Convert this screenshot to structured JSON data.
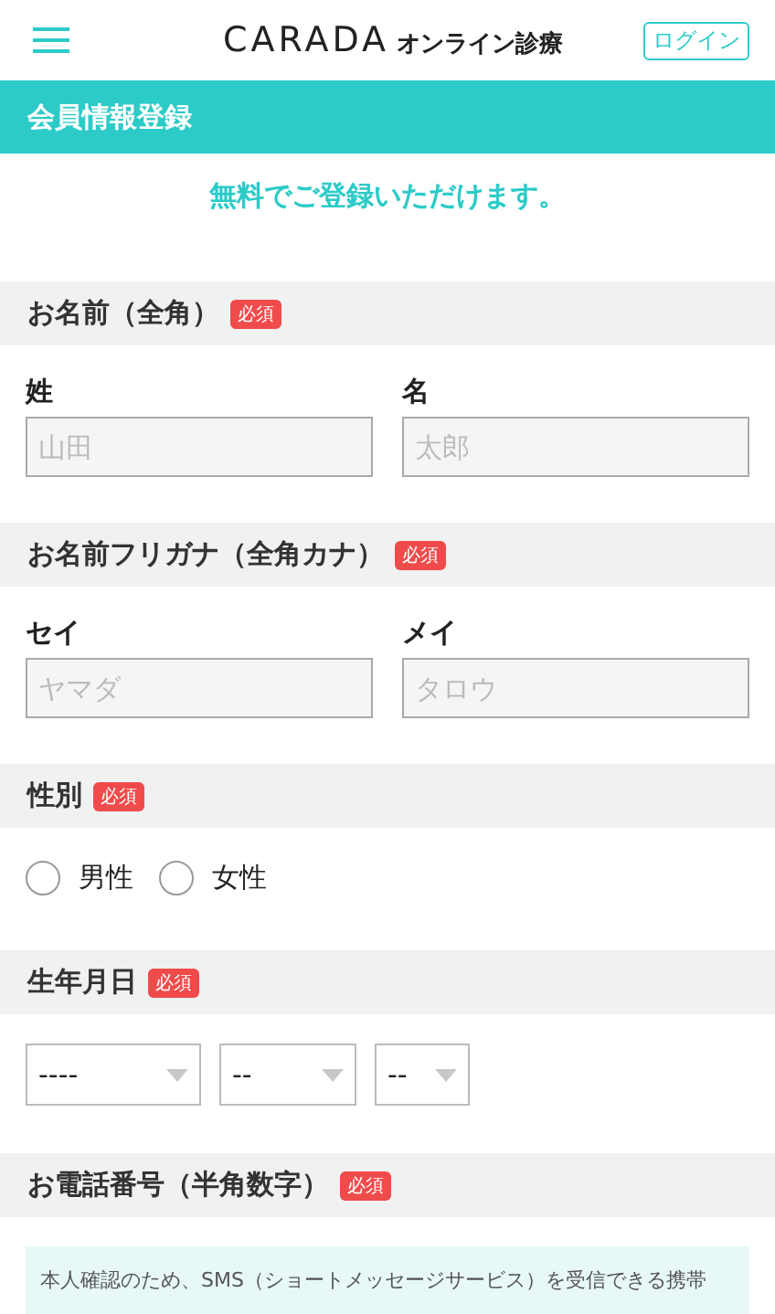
{
  "header": {
    "logo": "CARADA",
    "logo_sub": "オンライン診療",
    "login": "ログイン"
  },
  "page_title": "会員情報登録",
  "lead": "無料でご登録いただけます。",
  "sections": [
    {
      "kind": "text_pair",
      "title": "お名前（全角）",
      "badge": "必須",
      "fields": [
        {
          "label": "姓",
          "placeholder": "山田"
        },
        {
          "label": "名",
          "placeholder": "太郎"
        }
      ]
    },
    {
      "kind": "text_pair",
      "title": "お名前フリガナ（全角カナ）",
      "badge": "必須",
      "fields": [
        {
          "label": "セイ",
          "placeholder": "ヤマダ"
        },
        {
          "label": "メイ",
          "placeholder": "タロウ"
        }
      ]
    },
    {
      "kind": "radio",
      "title": "性別",
      "badge": "必須",
      "options": [
        {
          "label": "男性",
          "selected": false
        },
        {
          "label": "女性",
          "selected": false
        }
      ]
    },
    {
      "kind": "date",
      "title": "生年月日",
      "badge": "必須",
      "selects": [
        {
          "value": "----"
        },
        {
          "value": "--"
        },
        {
          "value": "--"
        }
      ]
    },
    {
      "kind": "note",
      "title": "お電話番号（半角数字）",
      "badge": "必須",
      "note": "本人確認のため、SMS（ショートメッセージサービス）を受信できる携帯"
    }
  ]
}
